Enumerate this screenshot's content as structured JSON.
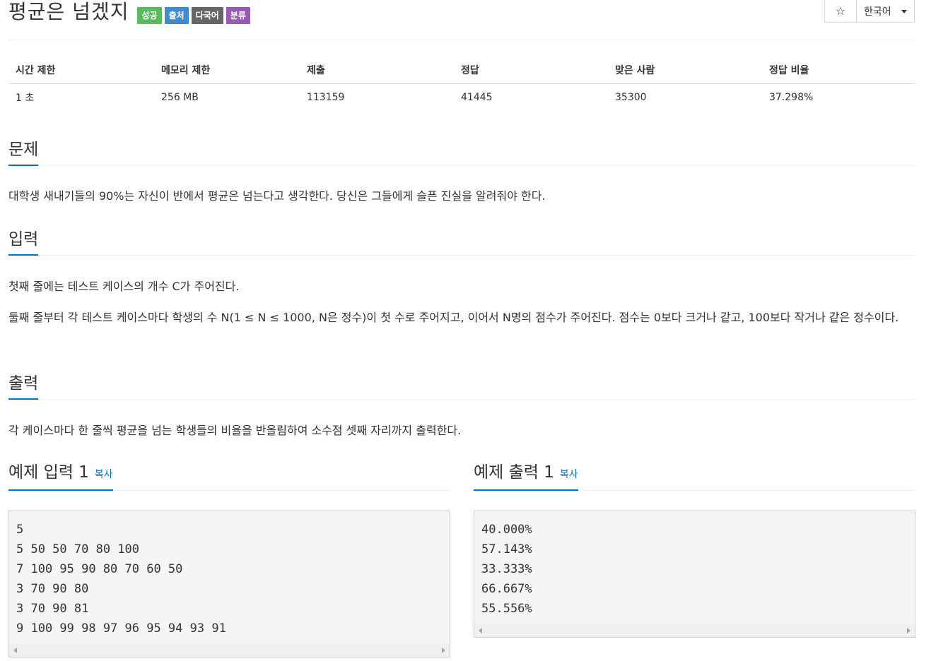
{
  "header": {
    "title": "평균은 넘겠지",
    "badges": [
      "성공",
      "출처",
      "다국어",
      "분류"
    ],
    "star": "☆",
    "language": "한국어"
  },
  "info_table": {
    "headers": [
      "시간 제한",
      "메모리 제한",
      "제출",
      "정답",
      "맞은 사람",
      "정답 비율"
    ],
    "values": [
      "1 초",
      "256 MB",
      "113159",
      "41445",
      "35300",
      "37.298%"
    ]
  },
  "problem": {
    "heading": "문제",
    "text": "대학생 새내기들의 90%는 자신이 반에서 평균은 넘는다고 생각한다. 당신은 그들에게 슬픈 진실을 알려줘야 한다."
  },
  "input": {
    "heading": "입력",
    "lines": [
      "첫째 줄에는 테스트 케이스의 개수 C가 주어진다.",
      "둘째 줄부터 각 테스트 케이스마다 학생의 수 N(1 ≤ N ≤ 1000, N은 정수)이 첫 수로 주어지고, 이어서 N명의 점수가 주어진다. 점수는 0보다 크거나 같고, 100보다 작거나 같은 정수이다."
    ]
  },
  "output": {
    "heading": "출력",
    "text": "각 케이스마다 한 줄씩 평균을 넘는 학생들의 비율을 반올림하여 소수점 셋째 자리까지 출력한다."
  },
  "sample_input": {
    "heading": "예제 입력 1",
    "copy": "복사",
    "content": "5\n5 50 50 70 80 100\n7 100 95 90 80 70 60 50\n3 70 90 80\n3 70 90 81\n9 100 99 98 97 96 95 94 93 91"
  },
  "sample_output": {
    "heading": "예제 출력 1",
    "copy": "복사",
    "content": "40.000%\n57.143%\n33.333%\n66.667%\n55.556%"
  }
}
